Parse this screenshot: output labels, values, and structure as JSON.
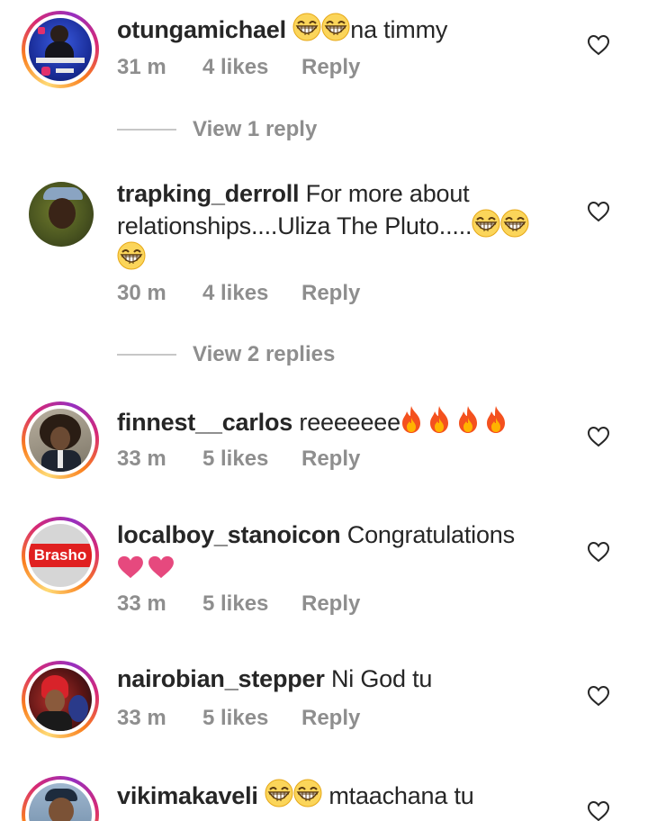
{
  "comments": [
    {
      "username": "otungamichael",
      "text_after": "na timmy",
      "emojis_before": [
        "grin-squint-emoji",
        "grin-squint-emoji"
      ],
      "time": "31 m",
      "likes": "4 likes",
      "reply": "Reply",
      "view_replies": "View 1 reply"
    },
    {
      "username": "trapking_derroll",
      "line1": "For more about",
      "line2": "relationships....Uliza The Pluto.....",
      "time": "30 m",
      "likes": "4 likes",
      "reply": "Reply",
      "view_replies": "View 2 replies"
    },
    {
      "username": "finnest__carlos",
      "text": "reeeeeee",
      "time": "33 m",
      "likes": "5 likes",
      "reply": "Reply"
    },
    {
      "username": "localboy_stanoicon",
      "text": "Congratulations",
      "avatar_label": "Brasho",
      "time": "33 m",
      "likes": "5 likes",
      "reply": "Reply"
    },
    {
      "username": "nairobian_stepper",
      "text": "Ni God tu",
      "time": "33 m",
      "likes": "5 likes",
      "reply": "Reply"
    },
    {
      "username": "vikimakaveli",
      "text": "mtaachana tu"
    }
  ],
  "colors": {
    "username": "#262626",
    "meta": "#8e8e8e",
    "heart_emoji": "#e6497e",
    "fire_outer": "#f4511e",
    "brasho_red": "#e02020"
  }
}
